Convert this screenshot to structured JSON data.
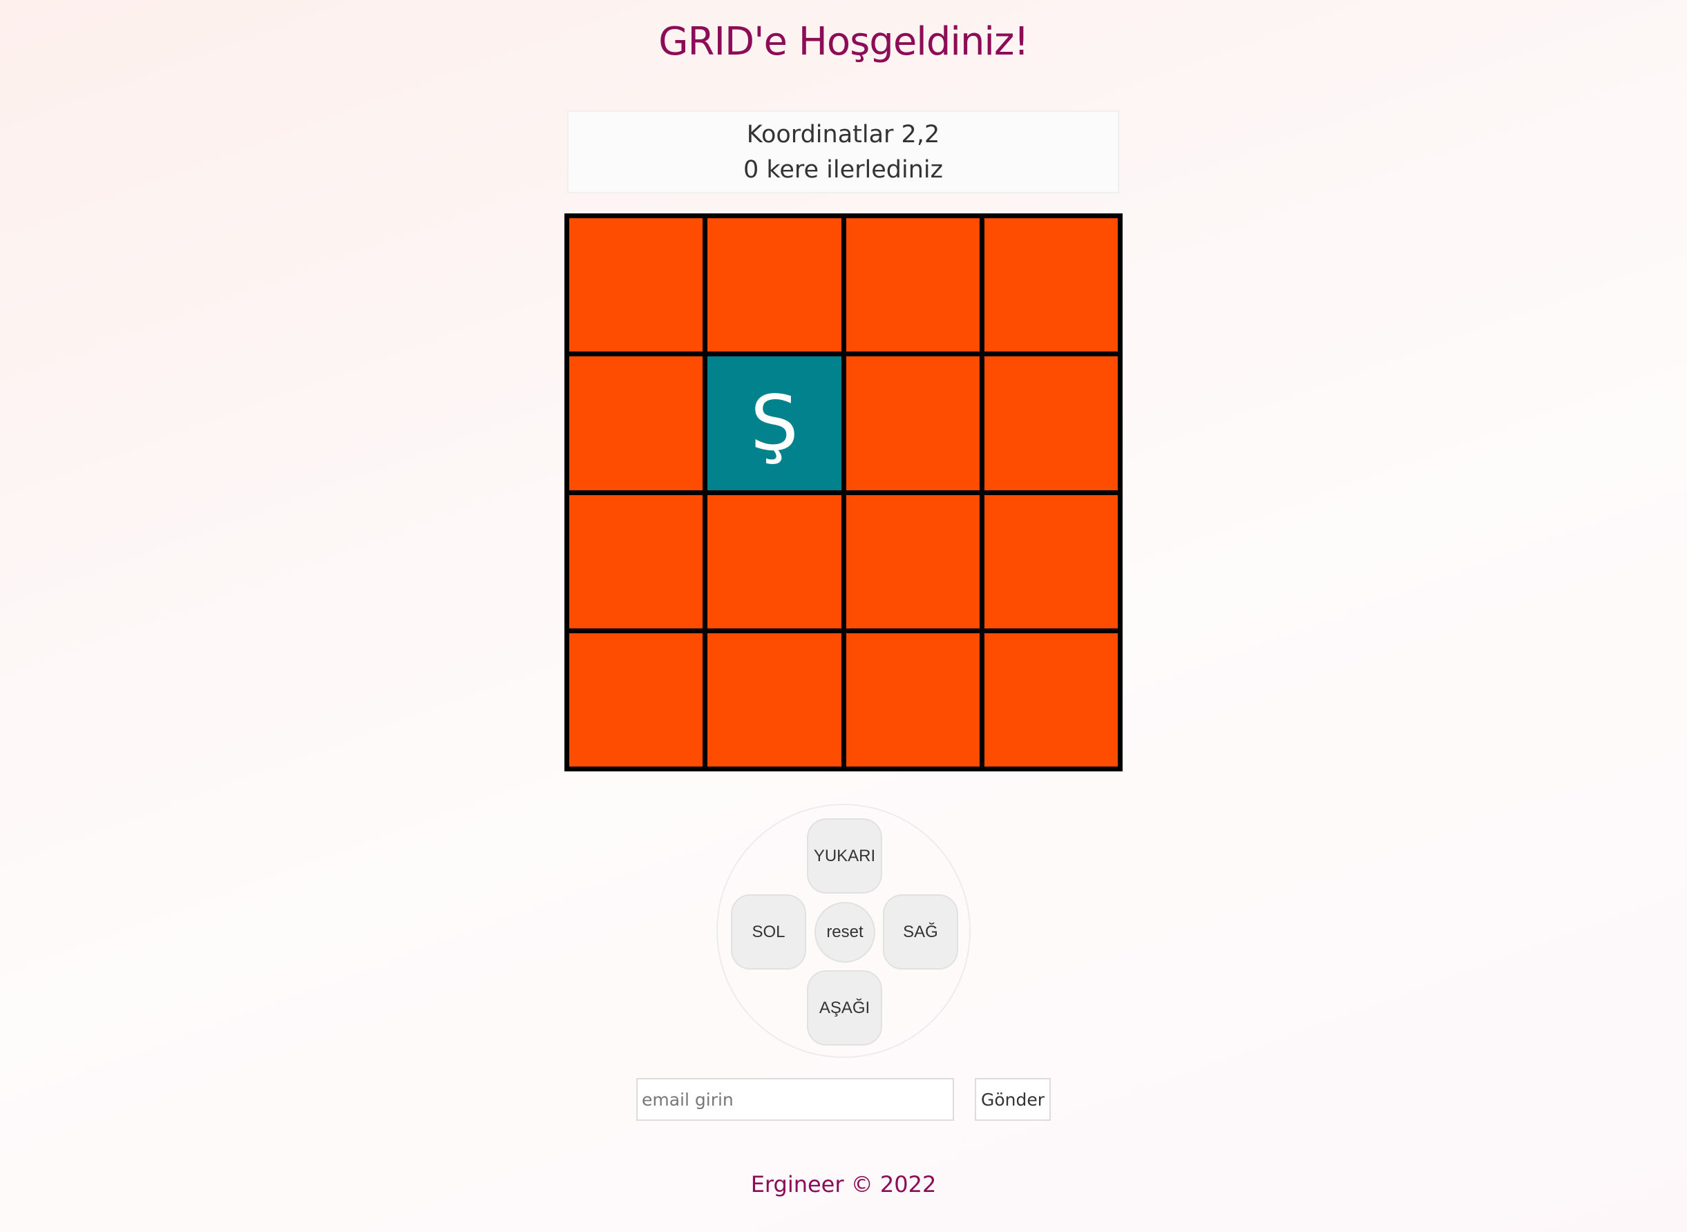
{
  "header": {
    "title": "GRID'e Hoşgeldiniz!"
  },
  "info": {
    "coordinates": "Koordinatlar 2,2",
    "steps": "0 kere ilerlediniz"
  },
  "grid": {
    "rows": 4,
    "cols": 4,
    "active_row": 2,
    "active_col": 2,
    "active_marker": "Ş",
    "cell_color": "#fe4d01",
    "active_color": "#01828d"
  },
  "controls": {
    "up_label": "YUKARI",
    "left_label": "SOL",
    "reset_label": "reset",
    "right_label": "SAĞ",
    "down_label": "AŞAĞI"
  },
  "form": {
    "email_placeholder": "email girin",
    "email_value": "",
    "submit_label": "Gönder"
  },
  "footer": {
    "text": "Ergineer © 2022"
  },
  "colors": {
    "accent": "#8d0c58"
  }
}
